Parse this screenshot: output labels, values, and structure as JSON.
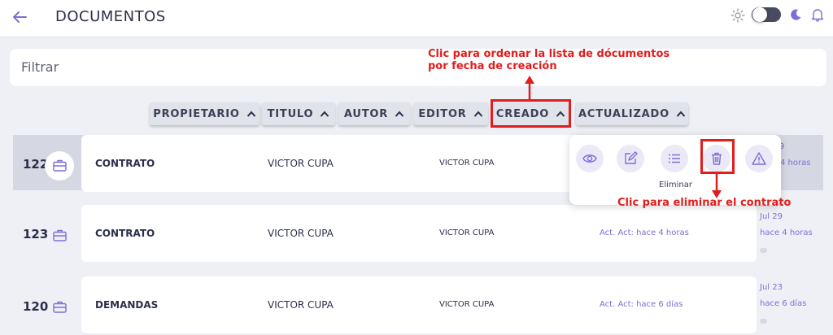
{
  "header": {
    "title": "DOCUMENTOS"
  },
  "filter": {
    "placeholder": "Filtrar"
  },
  "annotations": {
    "sort_note_line1": "Clic para ordenar la lista de dócumentos",
    "sort_note_line2": "por fecha de creación",
    "delete_note": "Clic para eliminar el contrato"
  },
  "sort_buttons": [
    {
      "label": "PROPIETARIO"
    },
    {
      "label": "TITULO"
    },
    {
      "label": "AUTOR"
    },
    {
      "label": "EDITOR"
    },
    {
      "label": "CREADO"
    },
    {
      "label": "ACTUALIZADO"
    }
  ],
  "rows": [
    {
      "number": "122",
      "title": "CONTRATO",
      "author": "VICTOR CUPA",
      "editor": "VICTOR CUPA",
      "updated": "",
      "side_date": "9",
      "side_ago": "4 horas"
    },
    {
      "number": "123",
      "title": "CONTRATO",
      "author": "VICTOR CUPA",
      "editor": "VICTOR CUPA",
      "updated": "Act. Act: hace 4 horas",
      "side_date": "Jul 29",
      "side_ago": "hace 4 horas"
    },
    {
      "number": "120",
      "title": "DEMANDAS",
      "author": "VICTOR CUPA",
      "editor": "VICTOR CUPA",
      "updated": "Act. Act: hace 6 días",
      "side_date": "Jul 23",
      "side_ago": "hace 6 días"
    }
  ],
  "actions": {
    "tooltip": "Eliminar",
    "icons": [
      "eye-icon",
      "edit-icon",
      "list-icon",
      "trash-icon",
      "warning-icon"
    ]
  },
  "colors": {
    "accent": "#7b6fd6",
    "annotation": "#e21d1d",
    "selected_row": "#d5d8e3"
  }
}
